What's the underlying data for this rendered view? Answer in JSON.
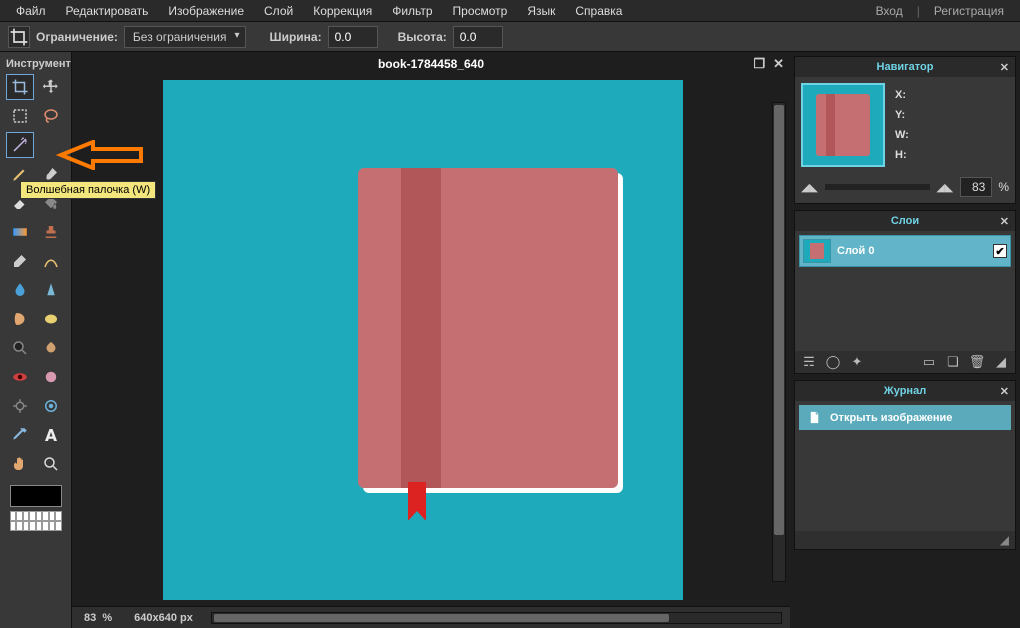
{
  "menu": {
    "file": "Файл",
    "edit": "Редактировать",
    "image": "Изображение",
    "layer": "Слой",
    "adjust": "Коррекция",
    "filter": "Фильтр",
    "view": "Просмотр",
    "lang": "Язык",
    "help": "Справка",
    "login": "Вход",
    "register": "Регистрация",
    "sep": "|"
  },
  "options": {
    "constraint_label": "Ограничение:",
    "constraint_value": "Без ограничения",
    "width_label": "Ширина:",
    "width_value": "0.0",
    "height_label": "Высота:",
    "height_value": "0.0"
  },
  "toolbox": {
    "title": "Инструмент",
    "tooltip": "Волшебная палочка (W)"
  },
  "document": {
    "title": "book-1784458_640",
    "dims": "640x640 px",
    "zoom": "83",
    "percent": "%"
  },
  "navigator": {
    "title": "Навигатор",
    "x_label": "X:",
    "y_label": "Y:",
    "w_label": "W:",
    "h_label": "H:",
    "zoom": "83",
    "percent": "%"
  },
  "layers": {
    "title": "Слои",
    "layer0": "Слой 0",
    "check": "✔"
  },
  "history": {
    "title": "Журнал",
    "item0": "Открыть изображение"
  }
}
